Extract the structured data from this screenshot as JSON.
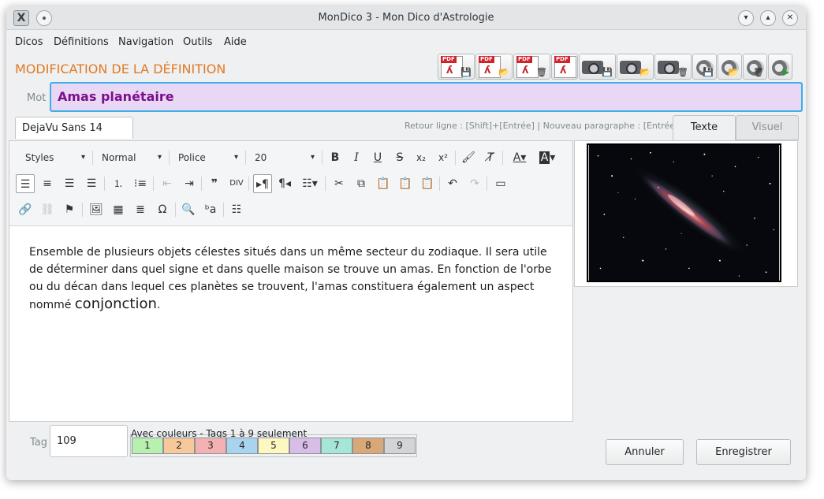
{
  "window": {
    "title": "MonDico 3 - Mon Dico d'Astrologie",
    "app_icon_glyph": "X",
    "icons": [
      "pin-icon",
      "minimize-icon",
      "maximize-icon",
      "close-icon"
    ]
  },
  "menu": [
    "Dicos",
    "Définitions",
    "Navigation",
    "Outils",
    "Aide"
  ],
  "section_title": "MODIFICATION DE LA DÉFINITION",
  "file_toolbar": {
    "pdf_label": "PDF",
    "buttons": [
      "pdf-save-icon",
      "pdf-open-icon",
      "pdf-delete-icon",
      "pdf-view-icon",
      "photo-save-icon",
      "photo-open-icon",
      "photo-delete-icon",
      "sound-save-icon",
      "sound-open-icon",
      "sound-delete-icon",
      "sound-play-icon"
    ]
  },
  "mot": {
    "label": "Mot",
    "value": "Amas planétaire"
  },
  "font_field": "DejaVu Sans 14",
  "hint": "Retour ligne : [Shift]+[Entrée] | Nouveau paragraphe : [Entrée]",
  "tabs": {
    "texte": "Texte",
    "visuel": "Visuel"
  },
  "editor": {
    "dropdowns": {
      "styles": "Styles",
      "format": "Normal",
      "font": "Police",
      "size": "20"
    },
    "content_main": "Ensemble de plusieurs objets célestes situés dans un même secteur du zodiaque. Il sera utile de déterminer dans quel signe et dans quelle maison se trouve un amas. En fonction de l'orbe ou du décan dans lequel ces planètes se trouvent, l'amas constituera également un aspect nommé ",
    "content_big": "conjonction",
    "content_end": "."
  },
  "tag": {
    "label": "Tag",
    "value": "109"
  },
  "colors": {
    "caption": "Avec couleurs - Tags 1 à 9 seulement",
    "buttons": [
      {
        "label": "1",
        "color": "#b8f0b0"
      },
      {
        "label": "2",
        "color": "#f7c99a"
      },
      {
        "label": "3",
        "color": "#f3b1b1"
      },
      {
        "label": "4",
        "color": "#a9d4ef"
      },
      {
        "label": "5",
        "color": "#fdf7c0"
      },
      {
        "label": "6",
        "color": "#d9bde9"
      },
      {
        "label": "7",
        "color": "#a5e6d6"
      },
      {
        "label": "8",
        "color": "#d9a878"
      },
      {
        "label": "9",
        "color": "#d4d4d4"
      }
    ]
  },
  "actions": {
    "cancel": "Annuler",
    "save": "Enregistrer"
  },
  "colors_accent": {
    "section_title": "#e07a25",
    "mot_text": "#7d0f8c",
    "mot_bg": "#e8d8f5",
    "focus": "#3daee9"
  }
}
